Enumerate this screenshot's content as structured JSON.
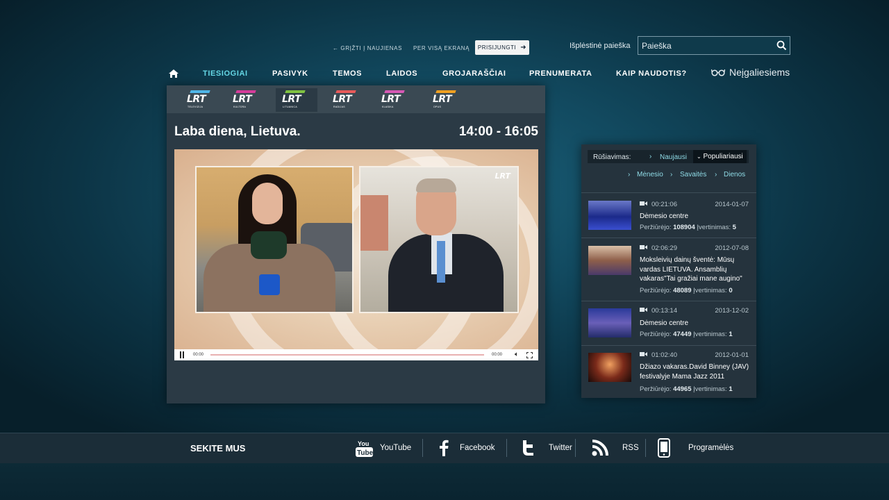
{
  "top": {
    "back_link": "← GRĮŽTI Į NAUJIENAS",
    "fullscreen_link": "PER VISĄ EKRANĄ",
    "login_label": "PRISIJUNGTI",
    "advanced_search": "Išplėstinė paieška",
    "search_placeholder": "Paieška"
  },
  "nav": {
    "items": [
      "TIESIOGIAI",
      "PASIVYK",
      "TEMOS",
      "LAIDOS",
      "GROJARAŠČIAI",
      "PRENUMERATA",
      "KAIP NAUDOTIS?"
    ],
    "active": "TIESIOGIAI",
    "accessibility": "Neįgaliesiems"
  },
  "channels": [
    {
      "logo": "LRT",
      "sub": "TELEVIZIJA",
      "color": "#4fb6e8"
    },
    {
      "logo": "LRT",
      "sub": "KULTŪRA",
      "color": "#d63c9a"
    },
    {
      "logo": "LRT",
      "sub": "LITUANICA",
      "color": "#7fc241"
    },
    {
      "logo": "LRT",
      "sub": "RADIJAS",
      "color": "#e85a5a"
    },
    {
      "logo": "LRT",
      "sub": "KLASIKA",
      "color": "#d658b4"
    },
    {
      "logo": "LRT",
      "sub": "OPUS",
      "color": "#f0a020"
    }
  ],
  "player": {
    "title": "Laba diena, Lietuva.",
    "time": "14:00 - 16:05",
    "current": "00:00",
    "duration": "00:00",
    "overlay_logo": "LRT"
  },
  "list": {
    "sort_label": "Rūšiavimas:",
    "sort_new": "Naujausi",
    "sort_popular": "Populiariausi",
    "periods": [
      "Mėnesio",
      "Savaitės",
      "Dienos"
    ],
    "views_label": "Peržiūrėjo:",
    "rating_label": "Įvertinimas:",
    "items": [
      {
        "duration": "00:21:06",
        "date": "2014-01-07",
        "title": "Dėmesio centre",
        "views": "108904",
        "rating": "5"
      },
      {
        "duration": "02:06:29",
        "date": "2012-07-08",
        "title": "Moksleivių dainų šventė: Mūsų vardas LIETUVA. Ansamblių vakaras\"Tai gražiai mane augino\"",
        "views": "48089",
        "rating": "0"
      },
      {
        "duration": "00:13:14",
        "date": "2013-12-02",
        "title": "Dėmesio centre",
        "views": "47449",
        "rating": "1"
      },
      {
        "duration": "01:02:40",
        "date": "2012-01-01",
        "title": "Džiazo vakaras.David Binney (JAV) festivalyje Mama Jazz 2011",
        "views": "44965",
        "rating": "1"
      }
    ]
  },
  "footer": {
    "follow": "SEKITE MUS",
    "youtube": "YouTube",
    "facebook": "Facebook",
    "twitter": "Twitter",
    "rss": "RSS",
    "apps": "Programėlės"
  },
  "colors": {
    "accent": "#66d8e6",
    "link": "#8fdbe6",
    "panel": "#25333d"
  }
}
